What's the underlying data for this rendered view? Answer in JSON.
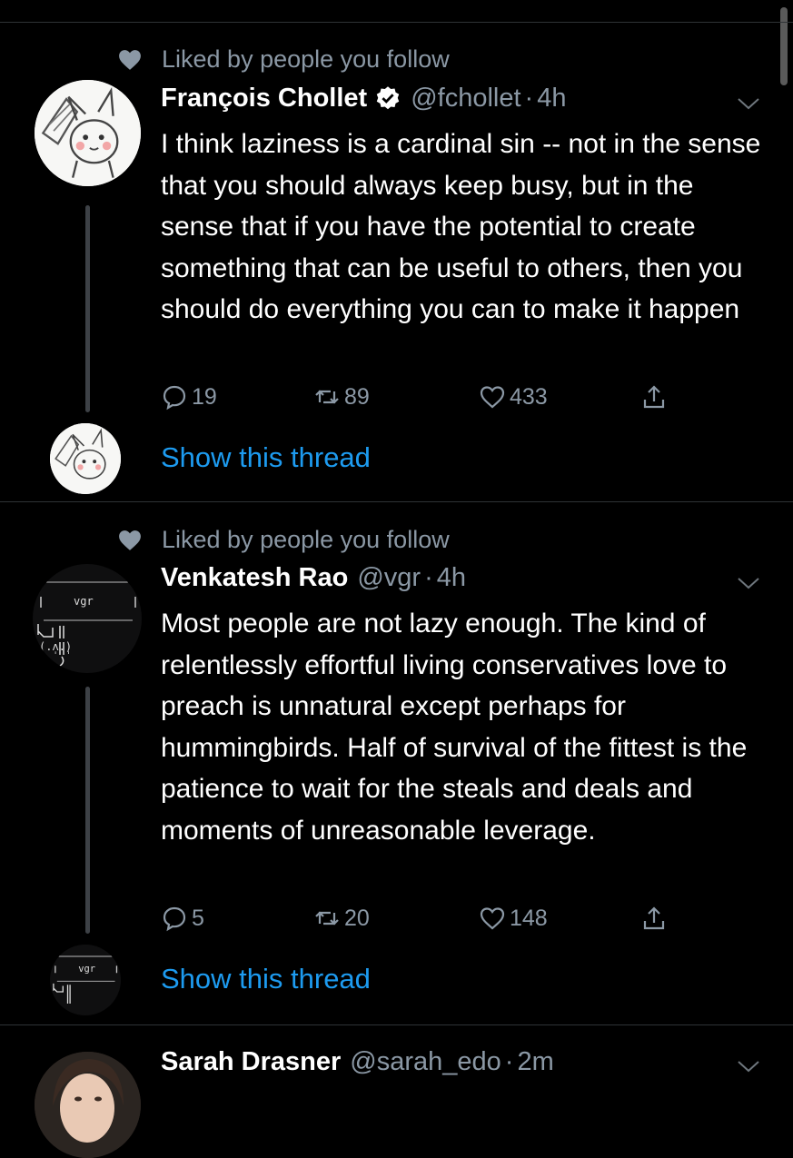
{
  "tweets": [
    {
      "social_context": "Liked by people you follow",
      "name": "François Chollet",
      "handle": "@fchollet",
      "time": "4h",
      "text": "I think laziness is a cardinal sin -- not in the sense that you should always keep busy, but in the sense that if you have the potential to create something that can be useful to others, then you should do everything you can to make it happen",
      "replies": "19",
      "retweets": "89",
      "likes": "433",
      "show_thread": "Show this thread"
    },
    {
      "social_context": "Liked by people you follow",
      "name": "Venkatesh Rao",
      "handle": "@vgr",
      "time": "4h",
      "avatar_text": "vgr",
      "text": "Most people are not lazy enough. The kind of relentlessly effortful living conservatives love to preach is unnatural except perhaps for hummingbirds. Half of survival of the fittest is the patience to wait for the steals and deals and moments of unreasonable leverage.",
      "replies": "5",
      "retweets": "20",
      "likes": "148",
      "show_thread": "Show this thread"
    },
    {
      "name": "Sarah Drasner",
      "handle": "@sarah_edo",
      "time": "2m"
    }
  ],
  "colors": {
    "accent": "#1d9bf0",
    "muted": "#8b98a5",
    "background": "#000000"
  }
}
